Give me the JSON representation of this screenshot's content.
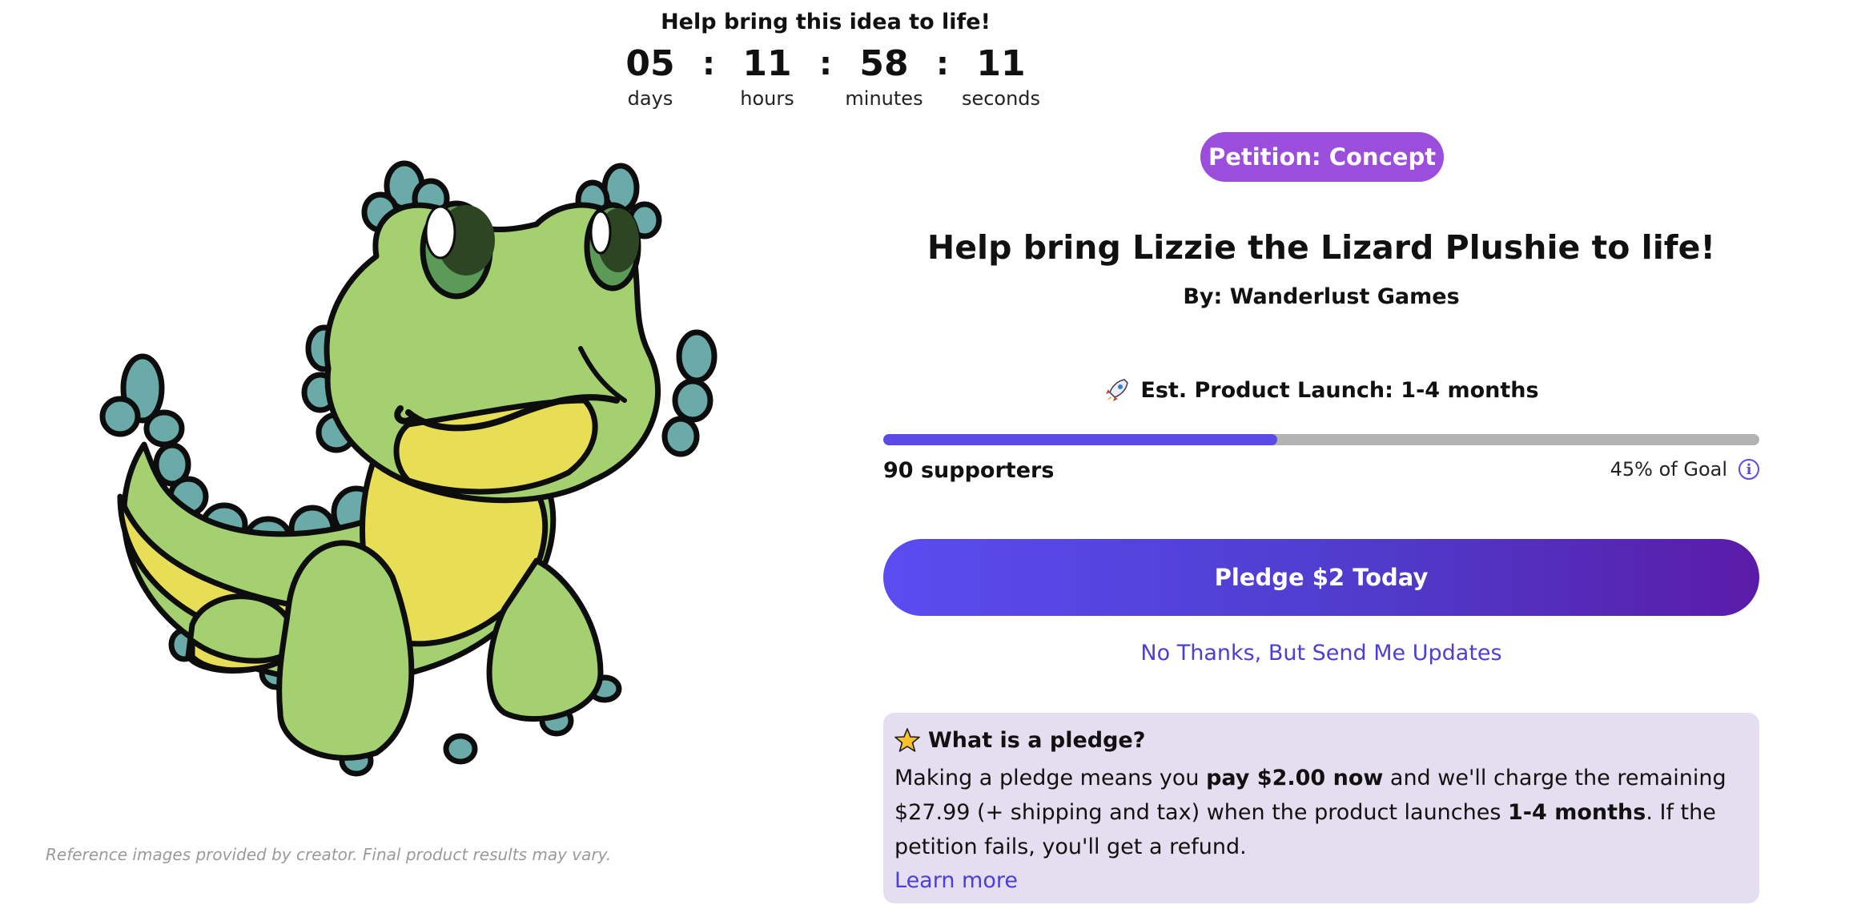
{
  "countdown": {
    "title": "Help bring this idea to life!",
    "days": "05",
    "days_label": "days",
    "hours": "11",
    "hours_label": "hours",
    "minutes": "58",
    "minutes_label": "minutes",
    "seconds": "11",
    "seconds_label": "seconds",
    "separator": ":"
  },
  "product": {
    "disclaimer": "Reference images provided by creator. Final product results may vary.",
    "badge": "Petition: Concept",
    "title": "Help bring Lizzie the Lizard Plushie to life!",
    "creator": "By: Wanderlust Games",
    "launch_icon": "rocket-icon",
    "launch": "Est. Product Launch: 1-4 months"
  },
  "progress": {
    "fraction": 0.45,
    "supporters": "90 supporters",
    "goal": "45% of Goal"
  },
  "actions": {
    "pledge_label": "Pledge $2 Today",
    "updates_label": "No Thanks, But Send Me Updates"
  },
  "pledge_info": {
    "icon": "star-icon",
    "heading": "What is a pledge?",
    "text_1": "Making a pledge means you ",
    "text_2": "pay $2.00 now",
    "text_3": " and we'll charge the remaining $27.99 (+ shipping and tax) when the product launches ",
    "text_4": "1-4 months",
    "text_5": ". If the petition fails, you'll get a refund.",
    "learn_more": "Learn more"
  },
  "colors": {
    "accent": "#5b4be6",
    "badge": "#9b4ddc",
    "info_bg": "#e5def0",
    "lizard_green": "#a4d070",
    "lizard_belly": "#e8de56",
    "lizard_spikes": "#6aaaa8"
  }
}
